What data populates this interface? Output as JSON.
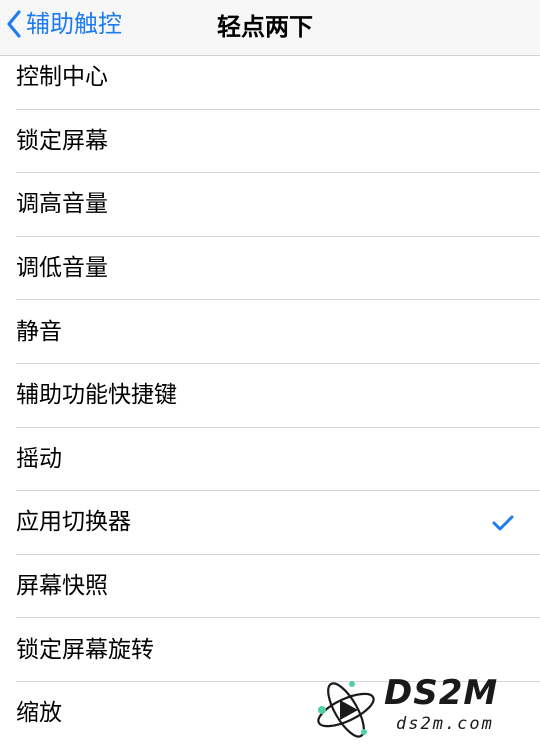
{
  "nav": {
    "back_label": "辅助触控",
    "title": "轻点两下"
  },
  "items": [
    {
      "label": "控制中心",
      "selected": false
    },
    {
      "label": "锁定屏幕",
      "selected": false
    },
    {
      "label": "调高音量",
      "selected": false
    },
    {
      "label": "调低音量",
      "selected": false
    },
    {
      "label": "静音",
      "selected": false
    },
    {
      "label": "辅助功能快捷键",
      "selected": false
    },
    {
      "label": "摇动",
      "selected": false
    },
    {
      "label": "应用切换器",
      "selected": true
    },
    {
      "label": "屏幕快照",
      "selected": false
    },
    {
      "label": "锁定屏幕旋转",
      "selected": false
    },
    {
      "label": "缩放",
      "selected": false
    }
  ],
  "icons": {
    "back": "chevron-left-icon",
    "selected": "checkmark-icon"
  },
  "colors": {
    "accent": "#1e7cf2",
    "separator": "#d6d6d6",
    "navbar_bg": "#f7f7f7"
  },
  "watermark": {
    "title": "DS2M",
    "subtitle": "ds2m.com"
  }
}
